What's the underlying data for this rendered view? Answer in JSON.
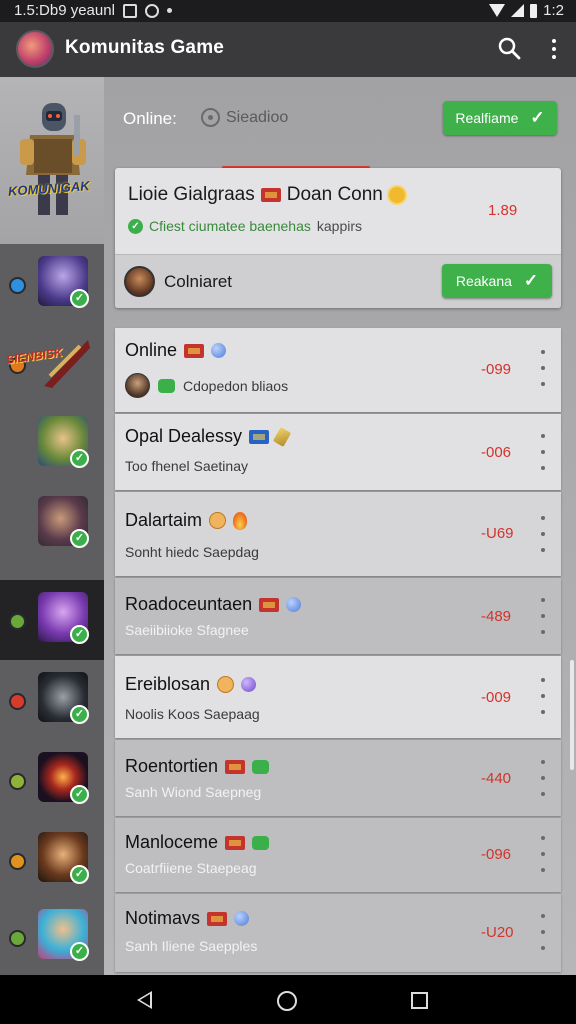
{
  "status_bar": {
    "time_left": "1.5:Db9 yeaunl",
    "time_right": "1:2"
  },
  "app_bar": {
    "title": "Komunitas Game"
  },
  "sidebar": {
    "hero_text": "KOMUNIGAK",
    "badge_text": "SIENBISK",
    "status_colors": [
      "#2f8fe0",
      "#e07a1e",
      "#6aa83a",
      "#d83a2e",
      "#8fb33a",
      "#e0921e",
      "#6aa83a"
    ]
  },
  "filter": {
    "online_label": "Online:",
    "sort_label": "Sieadioo",
    "button_label": "Realfiame"
  },
  "feature": {
    "title": "Lioie Gialgraas",
    "title2": "Doan Conn",
    "subtitle": "Cfiest ciumatee baenehas",
    "subtitle_extra": "kappirs",
    "price": "1.89",
    "user_name": "Colniaret",
    "user_button": "Reakana"
  },
  "rows": [
    {
      "title": "Online",
      "subtitle": "Cdopedon bliaos",
      "price": "-099"
    },
    {
      "title": "Opal Dealessy",
      "subtitle": "Too fhenel Saetinay",
      "price": "-006"
    },
    {
      "title": "Dalartaim",
      "subtitle": "Sonht hiedc Saepdag",
      "price": "-U69"
    },
    {
      "title": "Roadoceuntaen",
      "subtitle": "Saeiibiioke Sfagnee",
      "price": "-489"
    },
    {
      "title": "Ereiblosan",
      "subtitle": "Noolis Koos Saepaag",
      "price": "-009"
    },
    {
      "title": "Roentortien",
      "subtitle": "Sanh Wiond Saepneg",
      "price": "-440"
    },
    {
      "title": "Manloceme",
      "subtitle": "Coatrfiiene Staepeag",
      "price": "-096"
    },
    {
      "title": "Notimavs",
      "subtitle": "Sanh Iliene Saepples",
      "price": "-U20"
    }
  ]
}
